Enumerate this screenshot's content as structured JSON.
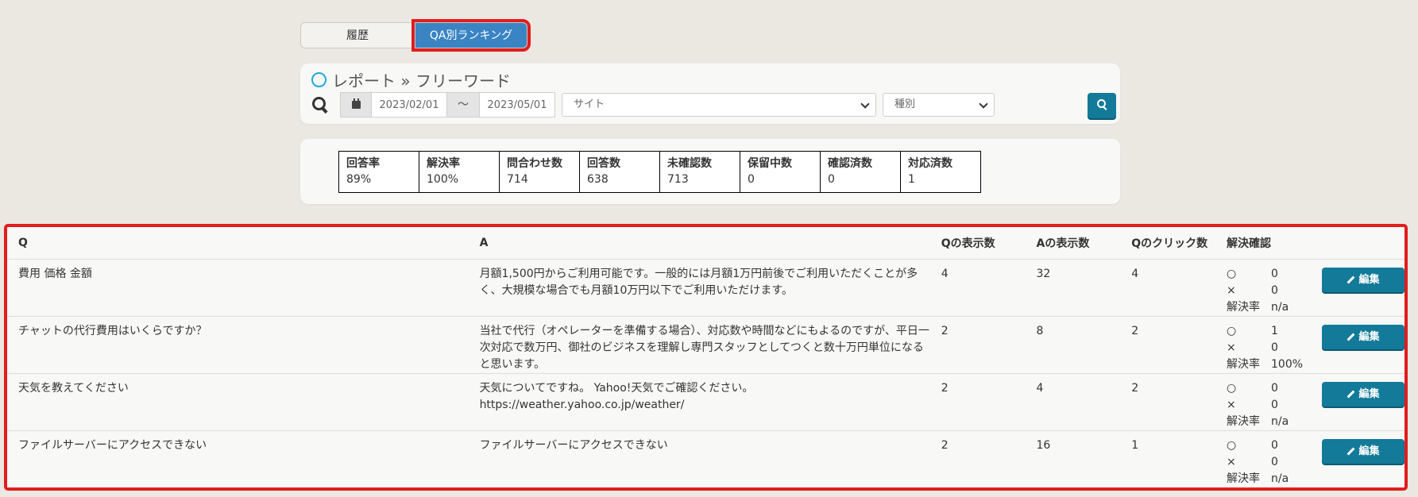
{
  "tabs": {
    "history": "履歴",
    "ranking": "QA別ランキング"
  },
  "report": {
    "title": "レポート » フリーワード",
    "date_from": "2023/02/01",
    "tilde": "～",
    "date_to": "2023/05/01",
    "site_select": "サイト",
    "type_select": "種別"
  },
  "stats": [
    {
      "label": "回答率",
      "value": "89%"
    },
    {
      "label": "解決率",
      "value": "100%"
    },
    {
      "label": "問合わせ数",
      "value": "714"
    },
    {
      "label": "回答数",
      "value": "638"
    },
    {
      "label": "未確認数",
      "value": "713"
    },
    {
      "label": "保留中数",
      "value": "0"
    },
    {
      "label": "確認済数",
      "value": "0"
    },
    {
      "label": "対応済数",
      "value": "1"
    }
  ],
  "table": {
    "headers": {
      "q": "Q",
      "a": "A",
      "q_views": "Qの表示数",
      "a_views": "Aの表示数",
      "q_clicks": "Qのクリック数",
      "resolution": "解決確認"
    },
    "res_labels": {
      "yes": "○",
      "no": "×",
      "rate": "解決率"
    },
    "edit_label": "編集",
    "rows": [
      {
        "q": "費用 価格 金額",
        "a": "月額1,500円からご利用可能です。一般的には月額1万円前後でご利用いただくことが多く、大規模な場合でも月額10万円以下でご利用いただけます。",
        "q_views": "4",
        "a_views": "32",
        "q_clicks": "4",
        "yes": "0",
        "no": "0",
        "rate": "n/a"
      },
      {
        "q": "チャットの代行費用はいくらですか？",
        "a": "当社で代行（オペレーターを準備する場合）、対応数や時間などにもよるのですが、平日一次対応で数万円、御社のビジネスを理解し専門スタッフとしてつくと数十万円単位になると思います。",
        "q_views": "2",
        "a_views": "8",
        "q_clicks": "2",
        "yes": "1",
        "no": "0",
        "rate": "100%"
      },
      {
        "q": "天気を教えてください",
        "a": "天気についてですね。 Yahoo!天気でご確認ください。 https://weather.yahoo.co.jp/weather/",
        "q_views": "2",
        "a_views": "4",
        "q_clicks": "2",
        "yes": "0",
        "no": "0",
        "rate": "n/a"
      },
      {
        "q": "ファイルサーバーにアクセスできない",
        "a": "ファイルサーバーにアクセスできない",
        "q_views": "2",
        "a_views": "16",
        "q_clicks": "1",
        "yes": "0",
        "no": "0",
        "rate": "n/a"
      }
    ]
  }
}
